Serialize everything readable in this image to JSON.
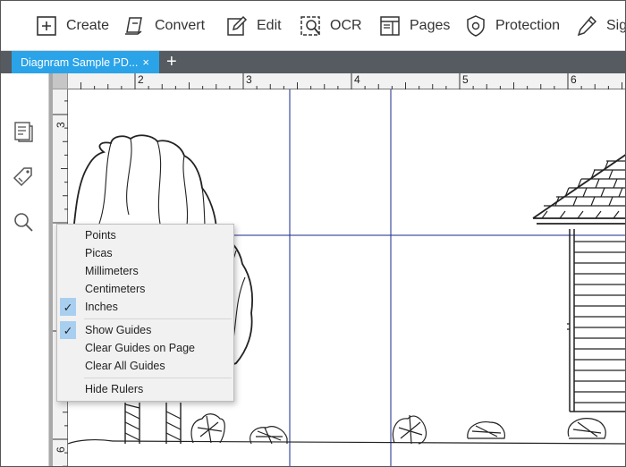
{
  "toolbar": {
    "items": [
      {
        "label": "Create",
        "icon": "plus-box-icon"
      },
      {
        "label": "Convert",
        "icon": "convert-icon"
      },
      {
        "label": "Edit",
        "icon": "edit-pencil-icon"
      },
      {
        "label": "OCR",
        "icon": "ocr-icon"
      },
      {
        "label": "Pages",
        "icon": "pages-icon"
      },
      {
        "label": "Protection",
        "icon": "shield-icon"
      },
      {
        "label": "Sign",
        "icon": "sign-pen-icon"
      }
    ]
  },
  "tabs": [
    {
      "label": "Diagnram Sample PD...",
      "close": "×"
    }
  ],
  "tab_add": "+",
  "left_rail": [
    "thumbnails-icon",
    "tag-icon",
    "search-icon"
  ],
  "ruler": {
    "horizontal_labels": [
      "2",
      "3",
      "4",
      "5",
      "6"
    ],
    "vertical_labels": [
      "3",
      "4",
      "5",
      "6"
    ]
  },
  "context_menu": {
    "units": [
      {
        "label": "Points",
        "checked": false
      },
      {
        "label": "Picas",
        "checked": false
      },
      {
        "label": "Millimeters",
        "checked": false
      },
      {
        "label": "Centimeters",
        "checked": false
      },
      {
        "label": "Inches",
        "checked": true
      }
    ],
    "guides": [
      {
        "label": "Show Guides",
        "checked": true
      },
      {
        "label": "Clear Guides on Page",
        "checked": false
      },
      {
        "label": "Clear All Guides",
        "checked": false
      }
    ],
    "hide": "Hide Rulers",
    "check_glyph": "✓"
  },
  "colors": {
    "tab_active": "#2aa3e8",
    "tabbar_bg": "#555b61",
    "guide_line": "#1a2a8a",
    "menu_check_bg": "#a9cff0"
  }
}
